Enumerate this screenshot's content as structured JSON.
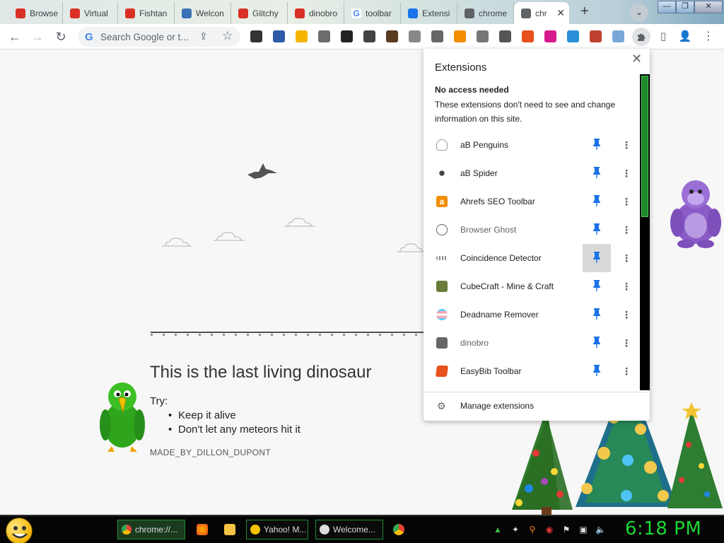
{
  "tabs": [
    {
      "title": "Browse",
      "favicon_color": "#d93025"
    },
    {
      "title": "Virtual",
      "favicon_color": "#d93025"
    },
    {
      "title": "Fishtan",
      "favicon_color": "#d93025"
    },
    {
      "title": "Welcon",
      "favicon_color": "#3b6fb6"
    },
    {
      "title": "Glitchy",
      "favicon_color": "#d93025"
    },
    {
      "title": "dinobro",
      "favicon_color": "#d93025"
    },
    {
      "title": "toolbar",
      "favicon_color": "#4285f4"
    },
    {
      "title": "Extensi",
      "favicon_color": "#1a73e8"
    },
    {
      "title": "chrome",
      "favicon_color": "#5f6368"
    },
    {
      "title": "chr",
      "favicon_color": "#5f6368",
      "active": true
    }
  ],
  "toolbar": {
    "search_placeholder": "Search Google or t..."
  },
  "toolbar_extensions": [
    {
      "icon": "mask-icon",
      "color": "#333333"
    },
    {
      "icon": "image-icon",
      "color": "#2e5aa8"
    },
    {
      "icon": "lightning-icon",
      "color": "#f4b400"
    },
    {
      "icon": "ublock-icon",
      "color": "#6c6c6c"
    },
    {
      "icon": "wp-icon",
      "color": "#222222"
    },
    {
      "icon": "game-icon",
      "color": "#444444"
    },
    {
      "icon": "face-icon",
      "color": "#5a3b1f"
    },
    {
      "icon": "penguin-icon",
      "color": "#888888"
    },
    {
      "icon": "spider-icon",
      "color": "#666666"
    },
    {
      "icon": "ahrefs-icon",
      "color": "#f28c00"
    },
    {
      "icon": "ghost-icon",
      "color": "#777777"
    },
    {
      "icon": "dinobro-icon",
      "color": "#555555"
    },
    {
      "icon": "easybib-icon",
      "color": "#e8501e"
    },
    {
      "icon": "rainbow-icon",
      "color": "#d81b8c"
    },
    {
      "icon": "s-icon",
      "color": "#2a8fd6"
    },
    {
      "icon": "candle-icon",
      "color": "#c04030"
    },
    {
      "icon": "window-icon",
      "color": "#7aa7d8"
    }
  ],
  "page": {
    "title": "This is the last living dinosaur",
    "try_label": "Try:",
    "tips": [
      "Keep it alive",
      "Don't let any meteors hit it"
    ],
    "credit": "MADE_BY_DILLON_DUPONT"
  },
  "extensions_popup": {
    "title": "Extensions",
    "section_title": "No access needed",
    "section_desc": "These extensions don't need to see and change information on this site.",
    "items": [
      {
        "name": "aB Penguins",
        "icon": "penguin-icon",
        "color": "#ffffff",
        "text": "",
        "pinned": true
      },
      {
        "name": "aB Spider",
        "icon": "spider-icon",
        "color": "#ffffff",
        "text": "",
        "pinned": true
      },
      {
        "name": "Ahrefs SEO Toolbar",
        "icon": "ahrefs-icon",
        "color": "#f28c00",
        "text": "a",
        "pinned": true
      },
      {
        "name": "Browser Ghost",
        "icon": "ghost-icon",
        "color": "#ffffff",
        "text": "",
        "pinned": true,
        "dim": true
      },
      {
        "name": "Coincidence Detector",
        "icon": "coincidence-icon",
        "color": "#ffffff",
        "text": "",
        "pinned": true
      },
      {
        "name": "CubeCraft - Mine & Craft",
        "icon": "cubecraft-icon",
        "color": "#6b7b3a",
        "text": "",
        "pinned": true
      },
      {
        "name": "Deadname Remover",
        "icon": "trans-flag-icon",
        "color": "#5bcefa",
        "text": "",
        "pinned": true
      },
      {
        "name": "dinobro",
        "icon": "dinobro-icon",
        "color": "#666666",
        "text": "",
        "pinned": true,
        "dim": true
      },
      {
        "name": "EasyBib Toolbar",
        "icon": "easybib-icon",
        "color": "#e8501e",
        "text": "",
        "pinned": true
      }
    ],
    "manage_label": "Manage extensions"
  },
  "taskbar": {
    "tasks": [
      {
        "label": "chrome://...",
        "icon_color": "#4285f4",
        "active": true
      },
      {
        "label": "Yahoo! M...",
        "icon_color": "#f7c300"
      },
      {
        "label": "Welcome...",
        "icon_color": "#dddddd"
      }
    ],
    "clock": "6:18 PM"
  },
  "colors": {
    "accent_pin": "#1a73e8",
    "clock_green": "#19d832",
    "task_border": "#1c8f2e"
  }
}
